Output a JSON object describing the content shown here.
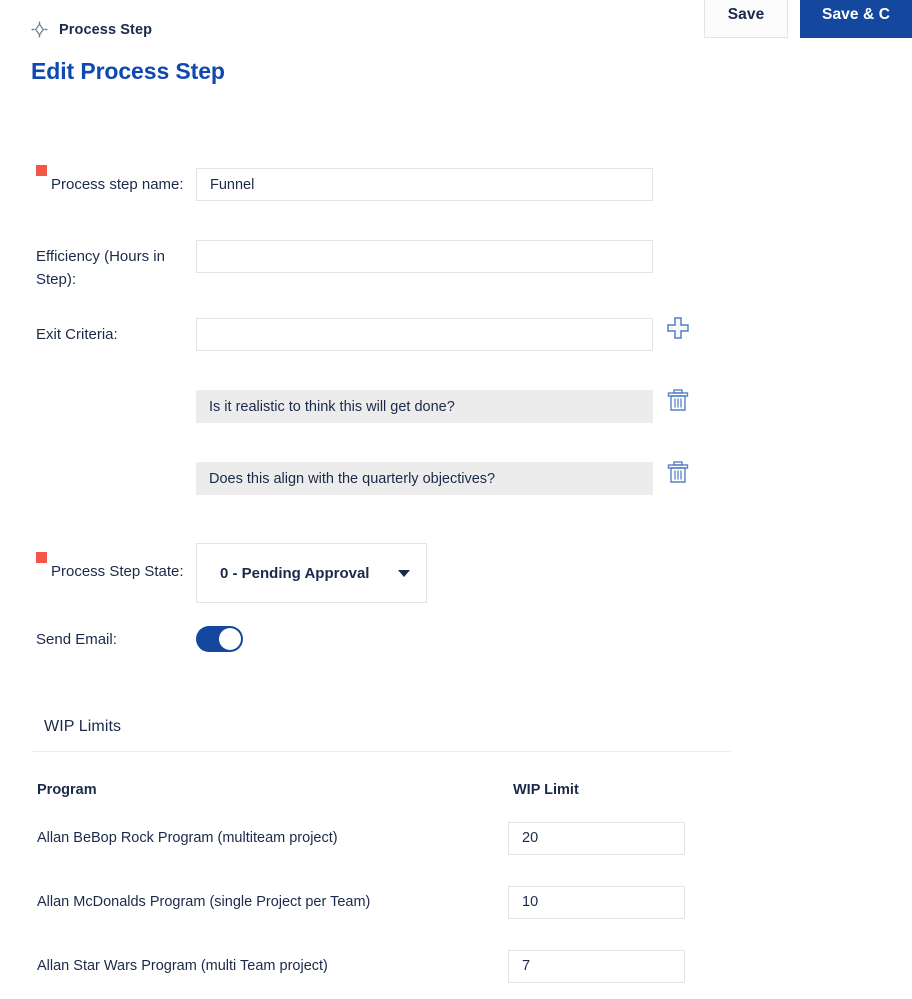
{
  "header": {
    "breadcrumb_label": "Process Step",
    "breadcrumb_icon": "crosshair-icon",
    "page_title": "Edit Process Step",
    "title_color": "#0f49b0",
    "save_label": "Save",
    "save_and_close_label": "Save & C"
  },
  "form": {
    "required_marker_color": "#f4564a",
    "process_step_name": {
      "label": "Process step name:",
      "value": "Funnel",
      "required": true
    },
    "efficiency": {
      "label": "Efficiency (Hours in Step):",
      "label_line1": "Efficiency (Hours in",
      "label_line2": "Step):",
      "value": "",
      "required": false
    },
    "exit_criteria": {
      "label": "Exit Criteria:",
      "value": "",
      "add_icon": "plus-icon",
      "delete_icon": "trash-icon",
      "items": [
        "Is it realistic to think this will get done?",
        "Does this align with the quarterly objectives?"
      ]
    },
    "process_step_state": {
      "label": "Process Step State:",
      "value": "0 - Pending Approval",
      "required": true,
      "caret_icon": "chevron-down-icon"
    },
    "send_email": {
      "label": "Send Email:",
      "enabled": true,
      "accent": "#14489f"
    }
  },
  "wip_limits": {
    "section_title": "WIP Limits",
    "columns": [
      "Program",
      "WIP Limit"
    ],
    "rows": [
      {
        "program": "Allan BeBop Rock Program (multiteam project)",
        "limit": "20"
      },
      {
        "program": "Allan McDonalds Program (single Project per Team)",
        "limit": "10"
      },
      {
        "program": "Allan Star Wars Program (multi Team project)",
        "limit": "7"
      }
    ]
  }
}
